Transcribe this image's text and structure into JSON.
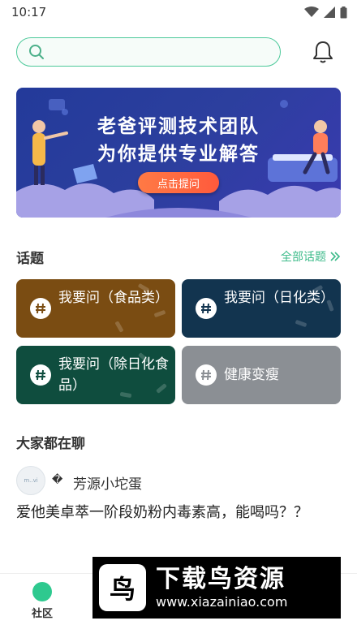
{
  "status_bar": {
    "time": "10:17"
  },
  "search": {
    "value": "",
    "placeholder": ""
  },
  "banner": {
    "line1": "老爸评测技术团队",
    "line2": "为你提供专业解答",
    "button": "点击提问"
  },
  "topics": {
    "title": "话题",
    "all_label": "全部话题",
    "items": [
      {
        "label": "我要问（食品类）",
        "color": "#7a4c12"
      },
      {
        "label": "我要问（日化类）",
        "color": "#12344f"
      },
      {
        "label": "我要问（除日化食品）",
        "color": "#0f4d3e"
      },
      {
        "label": "健康变瘦",
        "color": "#8b8f94"
      }
    ]
  },
  "feed": {
    "title": "大家都在聊",
    "post": {
      "avatar_text": "m..vi",
      "level": "�",
      "author": "芳源小坨蛋",
      "text": "爱他美卓萃一阶段奶粉内毒素高，能喝吗？？"
    }
  },
  "tab_bar": {
    "items": [
      {
        "label": "社区",
        "active": true
      },
      {
        "label": "",
        "active": false
      },
      {
        "label": "",
        "active": false
      },
      {
        "label": "",
        "active": false
      },
      {
        "label": "",
        "active": false
      }
    ]
  },
  "watermark": {
    "logo": "鸟",
    "title": "下载鸟资源",
    "url": "www.xiazainiao.com"
  },
  "colors": {
    "accent": "#3dbb8a",
    "banner_button": "#ff6a40",
    "banner_bg": "#2a3ea0"
  }
}
